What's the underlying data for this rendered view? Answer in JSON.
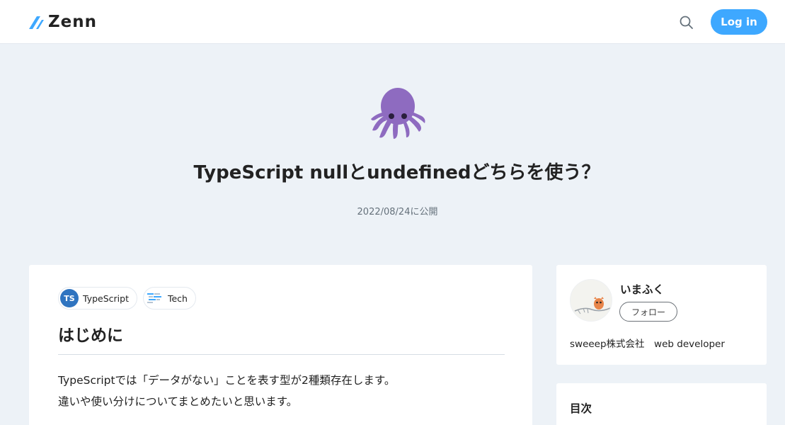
{
  "header": {
    "logo_text": "Zenn",
    "search_icon": "search-icon",
    "login_label": "Log in"
  },
  "article": {
    "emoji": "octopus",
    "title": "TypeScript nullとundefinedどちらを使う？",
    "published": "2022/08/24に公開",
    "topics": [
      {
        "label": "TypeScript",
        "icon": "TS"
      },
      {
        "label": "Tech",
        "icon": "tech-icon"
      }
    ],
    "heading": "はじめに",
    "paragraph_lines": [
      "TypeScriptでは「データがない」ことを表す型が2種類存在します。",
      "違いや使い分けについてまとめたいと思います。"
    ]
  },
  "author": {
    "name": "いまふく",
    "follow_label": "フォロー",
    "bio": "sweeep株式会社　web developer"
  },
  "toc": {
    "title": "目次"
  },
  "colors": {
    "accent": "#3ea8ff",
    "page_bg": "#edf2f7",
    "octopus": "#8e6bc0"
  }
}
